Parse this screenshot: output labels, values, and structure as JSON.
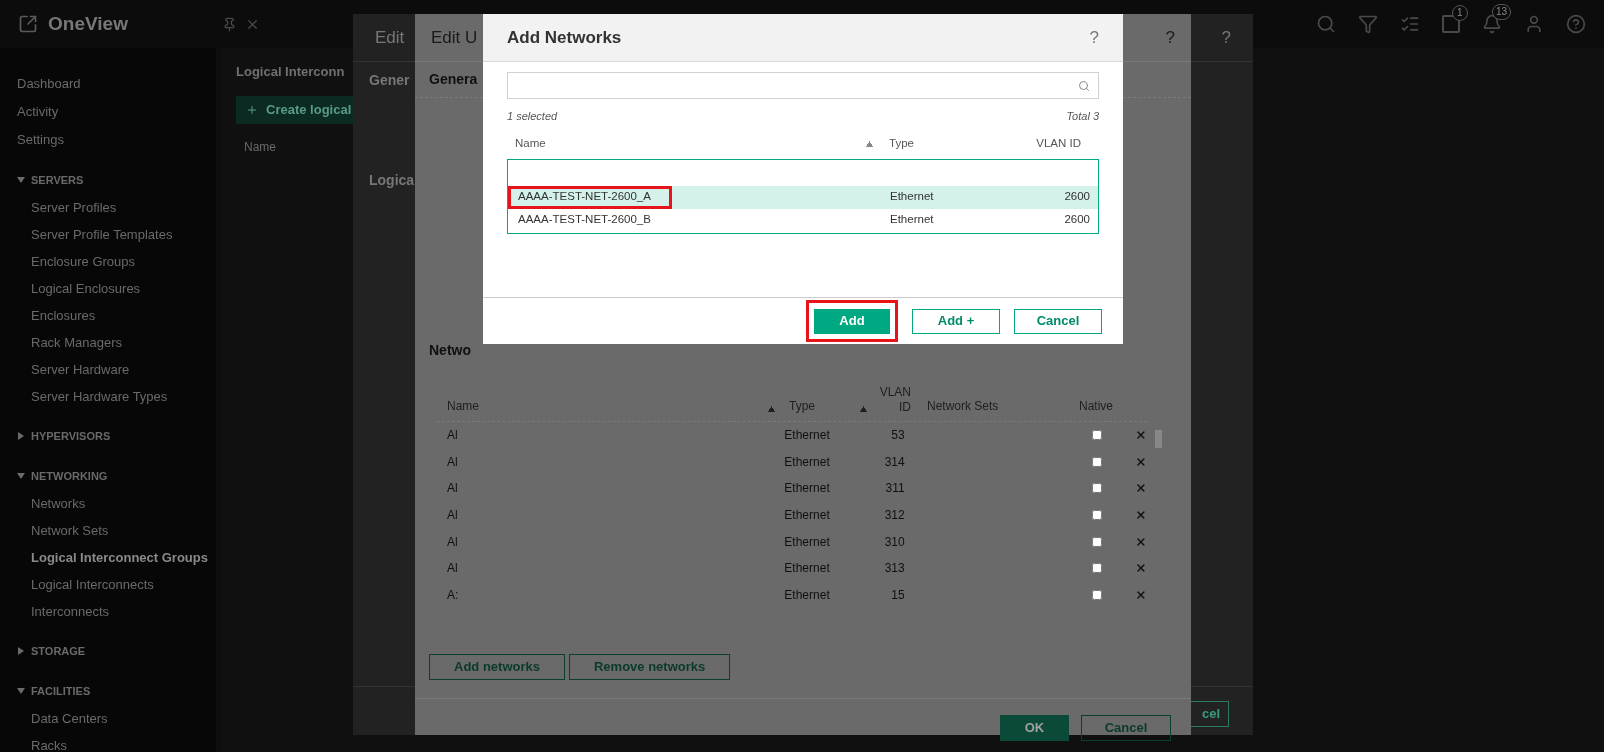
{
  "app": {
    "logo_text": "OneView",
    "alerts_badge": "1",
    "notifications_badge": "13"
  },
  "sidebar": {
    "items": [
      {
        "kind": "link",
        "label": "Dashboard",
        "selected": false
      },
      {
        "kind": "link",
        "label": "Activity",
        "selected": false
      },
      {
        "kind": "link",
        "label": "Settings",
        "selected": false
      },
      {
        "kind": "section",
        "label": "SERVERS",
        "expanded": true,
        "children": [
          {
            "label": "Server Profiles",
            "selected": false
          },
          {
            "label": "Server Profile Templates",
            "selected": false
          },
          {
            "label": "Enclosure Groups",
            "selected": false
          },
          {
            "label": "Logical Enclosures",
            "selected": false
          },
          {
            "label": "Enclosures",
            "selected": false
          },
          {
            "label": "Rack Managers",
            "selected": false
          },
          {
            "label": "Server Hardware",
            "selected": false
          },
          {
            "label": "Server Hardware Types",
            "selected": false
          }
        ]
      },
      {
        "kind": "section",
        "label": "HYPERVISORS",
        "expanded": false
      },
      {
        "kind": "section",
        "label": "NETWORKING",
        "expanded": true,
        "children": [
          {
            "label": "Networks",
            "selected": false
          },
          {
            "label": "Network Sets",
            "selected": false
          },
          {
            "label": "Logical Interconnect Groups",
            "selected": true
          },
          {
            "label": "Logical Interconnects",
            "selected": false
          },
          {
            "label": "Interconnects",
            "selected": false
          }
        ]
      },
      {
        "kind": "section",
        "label": "STORAGE",
        "expanded": false
      },
      {
        "kind": "section",
        "label": "FACILITIES",
        "expanded": true,
        "children": [
          {
            "label": "Data Centers",
            "selected": false
          },
          {
            "label": "Racks",
            "selected": false
          }
        ]
      }
    ]
  },
  "main": {
    "title": "Logical Interconn",
    "create_button": "Create logical",
    "table_columns": [
      "Name"
    ]
  },
  "edit_dialog": {
    "title": "Edit",
    "help": "?",
    "sections": [
      "Gener",
      "Logica"
    ],
    "cancel_fragment": "cel"
  },
  "edit_uplink_dialog": {
    "title": "Edit U",
    "help": "?",
    "general_heading": "Genera",
    "networks_heading": "Netwo",
    "columns": [
      {
        "label": "Name",
        "sortable": true
      },
      {
        "label": "Type",
        "sortable": true
      },
      {
        "label": "VLAN ID",
        "sortable": false
      },
      {
        "label": "Network Sets",
        "sortable": false
      },
      {
        "label": "Native",
        "sortable": false
      }
    ],
    "rows": [
      {
        "name": "Al",
        "type": "Ethernet",
        "vlan_id": "53",
        "native": false
      },
      {
        "name": "Al",
        "type": "Ethernet",
        "vlan_id": "314",
        "native": false
      },
      {
        "name": "Al",
        "type": "Ethernet",
        "vlan_id": "311",
        "native": false
      },
      {
        "name": "Al",
        "type": "Ethernet",
        "vlan_id": "312",
        "native": false
      },
      {
        "name": "Al",
        "type": "Ethernet",
        "vlan_id": "310",
        "native": false
      },
      {
        "name": "Al",
        "type": "Ethernet",
        "vlan_id": "313",
        "native": false
      },
      {
        "name": "A:",
        "type": "Ethernet",
        "vlan_id": "15",
        "native": false
      }
    ],
    "buttons": [
      "Add networks",
      "Remove networks"
    ],
    "ok": "OK",
    "cancel": "Cancel"
  },
  "add_networks": {
    "title": "Add Networks",
    "help": "?",
    "selected_count": "1 selected",
    "total": "Total 3",
    "columns": [
      {
        "label": "Name",
        "sorted": true
      },
      {
        "label": "Type",
        "sorted": false
      },
      {
        "label": "VLAN ID",
        "sorted": false
      }
    ],
    "rows": [
      {
        "name": "AAAA-TEST-NET-2600_A",
        "type": "Ethernet",
        "vlan_id": "2600",
        "selected": true,
        "highlighted": true
      },
      {
        "name": "AAAA-TEST-NET-2600_B",
        "type": "Ethernet",
        "vlan_id": "2600",
        "selected": false,
        "highlighted": false
      }
    ],
    "buttons": [
      {
        "label": "Add",
        "kind": "primary",
        "highlighted": true
      },
      {
        "label": "Add +",
        "kind": "secondary",
        "highlighted": false
      },
      {
        "label": "Cancel",
        "kind": "secondary",
        "highlighted": false
      }
    ]
  }
}
